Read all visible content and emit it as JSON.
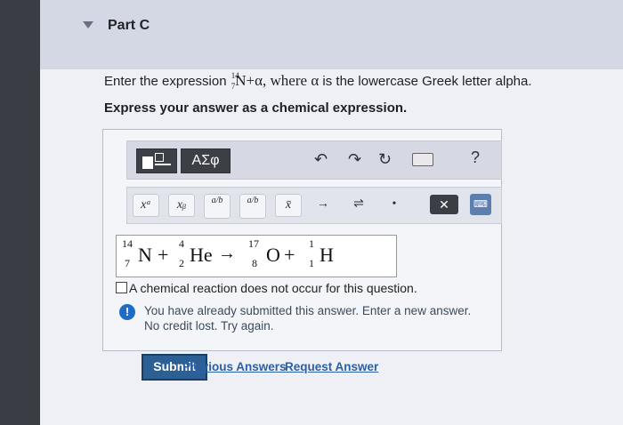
{
  "part": {
    "title": "Part C"
  },
  "question": {
    "prefix": "Enter the expression ",
    "nuclide": {
      "mass": "14",
      "atomic": "7",
      "symbol": "N"
    },
    "middle": "+α, where ",
    "alpha": "α",
    "suffix": " is the lowercase Greek letter alpha.",
    "instruction": "Express your answer as a chemical expression."
  },
  "toolbar": {
    "greek_label": "ΑΣφ",
    "undo_icon": "undo-icon",
    "redo_icon": "redo-icon",
    "reset_icon": "reset-icon",
    "keyboard_icon": "keyboard-icon",
    "help_label": "?",
    "tools": [
      {
        "name": "superscript",
        "label": "xᵃ"
      },
      {
        "name": "subscript",
        "label": "xᵦ"
      },
      {
        "name": "fraction",
        "label": "a/b"
      },
      {
        "name": "fraction-alt",
        "label": "a/b"
      },
      {
        "name": "overline",
        "label": "x̄"
      },
      {
        "name": "reaction-arrow",
        "label": "→"
      },
      {
        "name": "equilibrium-arrow",
        "label": "⇌"
      },
      {
        "name": "dot",
        "label": "•"
      }
    ],
    "delete_label": "✕",
    "keyboard_toggle_label": "⌨"
  },
  "answer": {
    "t1_mass": "14",
    "t1_num": "7",
    "t1_sym": "N",
    "plus1": "+",
    "t2_mass": "4",
    "t2_num": "2",
    "t2_sym": "He",
    "arrow": "→",
    "t3_mass": "17",
    "t3_num": "8",
    "t3_sym": "O",
    "plus2": "+",
    "t4_mass": "1",
    "t4_num": "1",
    "t4_sym": "H"
  },
  "no_reaction_label": "A chemical reaction does not occur for this question.",
  "feedback": {
    "icon": "!",
    "line1": "You have already submitted this answer. Enter a new answer.",
    "line2": "No credit lost. Try again."
  },
  "actions": {
    "submit": "Submit",
    "previous_answers": "Previous Answers",
    "request_answer": "Request Answer"
  }
}
